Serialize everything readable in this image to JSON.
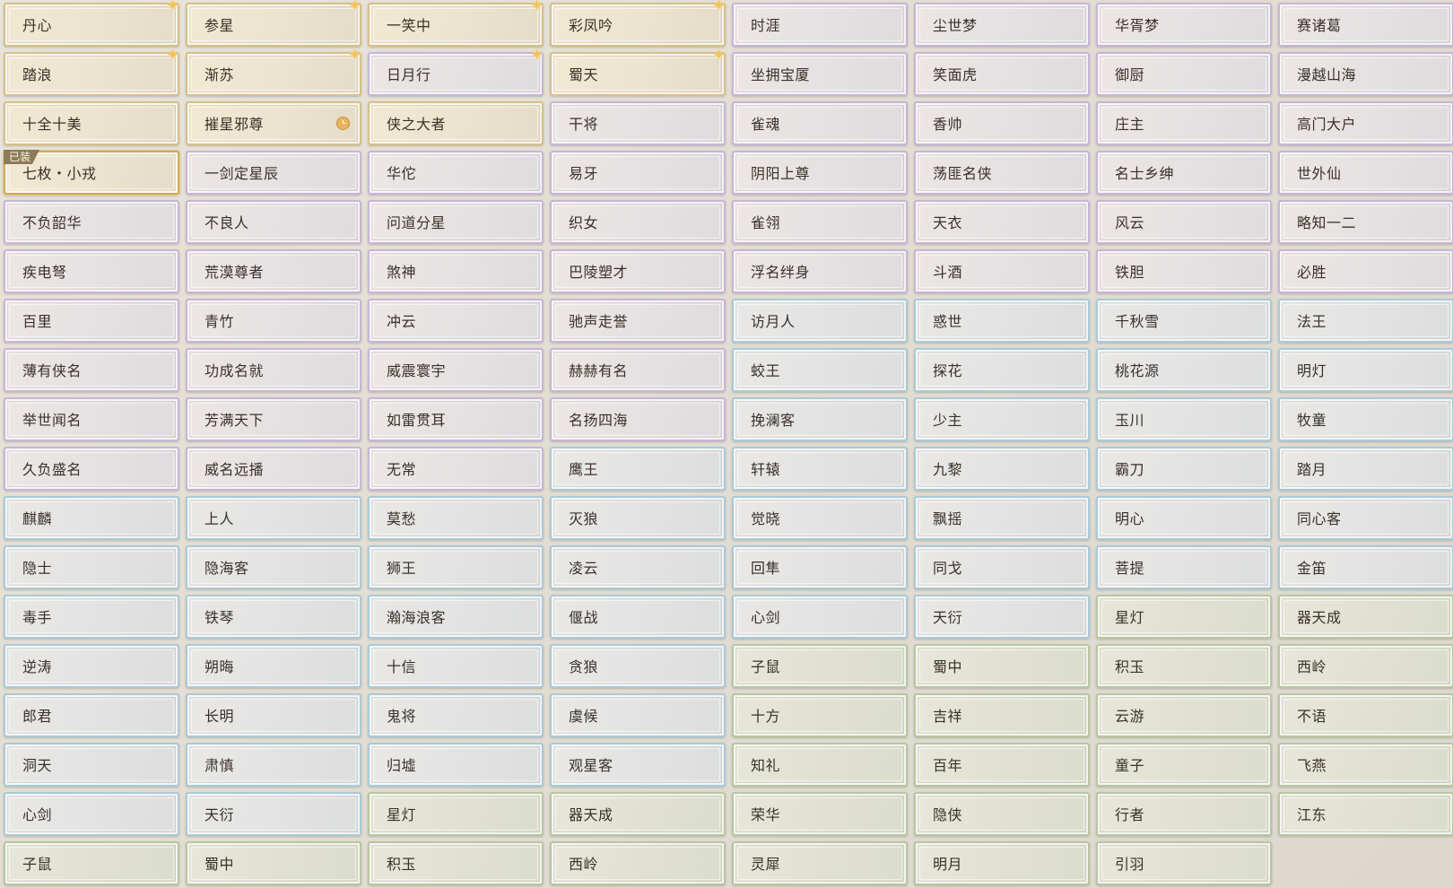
{
  "colors": {
    "gold": "#d8bf88",
    "purple": "#c7b5d9",
    "blue": "#a9cad9",
    "green": "#b7c79f",
    "text": "#3a3028",
    "badge": "#8d7a58"
  },
  "equipped_badge": "已装",
  "titles": [
    {
      "name": "丹心",
      "tier": "gold",
      "sparkle": true
    },
    {
      "name": "参星",
      "tier": "gold",
      "sparkle": true
    },
    {
      "name": "一笑中",
      "tier": "gold",
      "sparkle": true
    },
    {
      "name": "彩凤吟",
      "tier": "gold",
      "sparkle": true
    },
    {
      "name": "时涯",
      "tier": "purple"
    },
    {
      "name": "尘世梦",
      "tier": "purple"
    },
    {
      "name": "华胥梦",
      "tier": "purple"
    },
    {
      "name": "赛诸葛",
      "tier": "purple"
    },
    {
      "name": "踏浪",
      "tier": "gold",
      "sparkle": true
    },
    {
      "name": "渐苏",
      "tier": "gold",
      "sparkle": true
    },
    {
      "name": "日月行",
      "tier": "purple",
      "sparkle": true
    },
    {
      "name": "蜀天",
      "tier": "gold",
      "sparkle": true
    },
    {
      "name": "坐拥宝厦",
      "tier": "purple"
    },
    {
      "name": "笑面虎",
      "tier": "purple"
    },
    {
      "name": "御厨",
      "tier": "purple"
    },
    {
      "name": "漫越山海",
      "tier": "purple"
    },
    {
      "name": "十全十美",
      "tier": "gold"
    },
    {
      "name": "摧星邪尊",
      "tier": "gold",
      "clock": true
    },
    {
      "name": "侠之大者",
      "tier": "gold"
    },
    {
      "name": "干将",
      "tier": "purple"
    },
    {
      "name": "雀魂",
      "tier": "purple"
    },
    {
      "name": "香帅",
      "tier": "purple"
    },
    {
      "name": "庄主",
      "tier": "purple"
    },
    {
      "name": "高门大户",
      "tier": "purple"
    },
    {
      "name": "七枚・小戎",
      "tier": "gold",
      "equipped": true
    },
    {
      "name": "一剑定星辰",
      "tier": "purple"
    },
    {
      "name": "华佗",
      "tier": "purple"
    },
    {
      "name": "易牙",
      "tier": "purple"
    },
    {
      "name": "阴阳上尊",
      "tier": "purple"
    },
    {
      "name": "荡匪名侠",
      "tier": "purple"
    },
    {
      "name": "名士乡绅",
      "tier": "purple"
    },
    {
      "name": "世外仙",
      "tier": "purple"
    },
    {
      "name": "不负韶华",
      "tier": "purple"
    },
    {
      "name": "不良人",
      "tier": "purple"
    },
    {
      "name": "问道分星",
      "tier": "purple"
    },
    {
      "name": "织女",
      "tier": "purple"
    },
    {
      "name": "雀翎",
      "tier": "purple"
    },
    {
      "name": "天衣",
      "tier": "purple"
    },
    {
      "name": "风云",
      "tier": "purple"
    },
    {
      "name": "略知一二",
      "tier": "purple"
    },
    {
      "name": "疾电弩",
      "tier": "purple"
    },
    {
      "name": "荒漠尊者",
      "tier": "purple"
    },
    {
      "name": "煞神",
      "tier": "purple"
    },
    {
      "name": "巴陵塑才",
      "tier": "purple"
    },
    {
      "name": "浮名绊身",
      "tier": "purple"
    },
    {
      "name": "斗酒",
      "tier": "purple"
    },
    {
      "name": "铁胆",
      "tier": "purple"
    },
    {
      "name": "必胜",
      "tier": "purple"
    },
    {
      "name": "百里",
      "tier": "purple"
    },
    {
      "name": "青竹",
      "tier": "purple"
    },
    {
      "name": "冲云",
      "tier": "purple"
    },
    {
      "name": "驰声走誉",
      "tier": "purple"
    },
    {
      "name": "访月人",
      "tier": "blue"
    },
    {
      "name": "惑世",
      "tier": "blue"
    },
    {
      "name": "千秋雪",
      "tier": "blue"
    },
    {
      "name": "法王",
      "tier": "blue"
    },
    {
      "name": "薄有侠名",
      "tier": "purple"
    },
    {
      "name": "功成名就",
      "tier": "purple"
    },
    {
      "name": "威震寰宇",
      "tier": "purple"
    },
    {
      "name": "赫赫有名",
      "tier": "purple"
    },
    {
      "name": "蛟王",
      "tier": "blue"
    },
    {
      "name": "探花",
      "tier": "blue"
    },
    {
      "name": "桃花源",
      "tier": "blue"
    },
    {
      "name": "明灯",
      "tier": "blue"
    },
    {
      "name": "举世闻名",
      "tier": "purple"
    },
    {
      "name": "芳满天下",
      "tier": "purple"
    },
    {
      "name": "如雷贯耳",
      "tier": "purple"
    },
    {
      "name": "名扬四海",
      "tier": "purple"
    },
    {
      "name": "挽澜客",
      "tier": "blue"
    },
    {
      "name": "少主",
      "tier": "blue"
    },
    {
      "name": "玉川",
      "tier": "blue"
    },
    {
      "name": "牧童",
      "tier": "blue"
    },
    {
      "name": "久负盛名",
      "tier": "purple"
    },
    {
      "name": "威名远播",
      "tier": "purple"
    },
    {
      "name": "无常",
      "tier": "purple"
    },
    {
      "name": "鹰王",
      "tier": "blue"
    },
    {
      "name": "轩辕",
      "tier": "blue"
    },
    {
      "name": "九黎",
      "tier": "blue"
    },
    {
      "name": "霸刀",
      "tier": "blue"
    },
    {
      "name": "踏月",
      "tier": "blue"
    },
    {
      "name": "麒麟",
      "tier": "blue"
    },
    {
      "name": "上人",
      "tier": "blue"
    },
    {
      "name": "莫愁",
      "tier": "blue"
    },
    {
      "name": "灭狼",
      "tier": "blue"
    },
    {
      "name": "觉晓",
      "tier": "blue"
    },
    {
      "name": "飘摇",
      "tier": "blue"
    },
    {
      "name": "明心",
      "tier": "blue"
    },
    {
      "name": "同心客",
      "tier": "blue"
    },
    {
      "name": "隐士",
      "tier": "blue"
    },
    {
      "name": "隐海客",
      "tier": "blue"
    },
    {
      "name": "狮王",
      "tier": "blue"
    },
    {
      "name": "凌云",
      "tier": "blue"
    },
    {
      "name": "回隼",
      "tier": "blue"
    },
    {
      "name": "同戈",
      "tier": "blue"
    },
    {
      "name": "菩提",
      "tier": "blue"
    },
    {
      "name": "金笛",
      "tier": "blue"
    },
    {
      "name": "毒手",
      "tier": "blue"
    },
    {
      "name": "铁琴",
      "tier": "blue"
    },
    {
      "name": "瀚海浪客",
      "tier": "blue"
    },
    {
      "name": "偃战",
      "tier": "blue"
    },
    {
      "name": "心剑",
      "tier": "blue"
    },
    {
      "name": "天衍",
      "tier": "blue"
    },
    {
      "name": "星灯",
      "tier": "green"
    },
    {
      "name": "器天成",
      "tier": "green"
    },
    {
      "name": "逆涛",
      "tier": "blue"
    },
    {
      "name": "朔晦",
      "tier": "blue"
    },
    {
      "name": "十信",
      "tier": "blue"
    },
    {
      "name": "贪狼",
      "tier": "blue"
    },
    {
      "name": "子鼠",
      "tier": "green"
    },
    {
      "name": "蜀中",
      "tier": "green"
    },
    {
      "name": "积玉",
      "tier": "green"
    },
    {
      "name": "西岭",
      "tier": "green"
    },
    {
      "name": "郎君",
      "tier": "blue"
    },
    {
      "name": "长明",
      "tier": "blue"
    },
    {
      "name": "鬼将",
      "tier": "blue"
    },
    {
      "name": "虞候",
      "tier": "blue"
    },
    {
      "name": "十方",
      "tier": "green"
    },
    {
      "name": "吉祥",
      "tier": "green"
    },
    {
      "name": "云游",
      "tier": "green"
    },
    {
      "name": "不语",
      "tier": "green"
    },
    {
      "name": "洞天",
      "tier": "blue"
    },
    {
      "name": "肃慎",
      "tier": "blue"
    },
    {
      "name": "归墟",
      "tier": "blue"
    },
    {
      "name": "观星客",
      "tier": "blue"
    },
    {
      "name": "知礼",
      "tier": "green"
    },
    {
      "name": "百年",
      "tier": "green"
    },
    {
      "name": "童子",
      "tier": "green"
    },
    {
      "name": "飞燕",
      "tier": "green"
    },
    {
      "name": "心剑",
      "tier": "blue"
    },
    {
      "name": "天衍",
      "tier": "blue"
    },
    {
      "name": "星灯",
      "tier": "green"
    },
    {
      "name": "器天成",
      "tier": "green"
    },
    {
      "name": "荣华",
      "tier": "green"
    },
    {
      "name": "隐侠",
      "tier": "green"
    },
    {
      "name": "行者",
      "tier": "green"
    },
    {
      "name": "江东",
      "tier": "green"
    },
    {
      "name": "子鼠",
      "tier": "green"
    },
    {
      "name": "蜀中",
      "tier": "green"
    },
    {
      "name": "积玉",
      "tier": "green"
    },
    {
      "name": "西岭",
      "tier": "green"
    },
    {
      "name": "灵犀",
      "tier": "green"
    },
    {
      "name": "明月",
      "tier": "green"
    },
    {
      "name": "引羽",
      "tier": "green"
    }
  ]
}
